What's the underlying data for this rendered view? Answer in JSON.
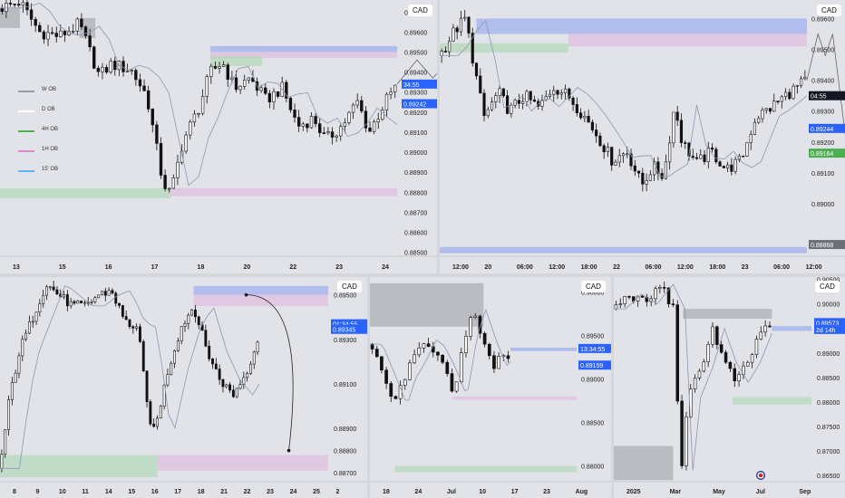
{
  "currency_tag": "CAD",
  "colors": {
    "bull": "#ffffff",
    "bear": "#111111",
    "wick": "#111111",
    "axis_text": "#222222",
    "blue_zone": "#8aa0f0",
    "pink_zone": "#e0b3df",
    "green_zone": "#a7d7a9",
    "gray_zone": "#9a9ca3",
    "label_blue": "#2962ff",
    "label_dark": "#131722",
    "label_green": "#4caf50"
  },
  "legend": [
    {
      "label": "W OB",
      "color": "#9a9ca3"
    },
    {
      "label": "D OB",
      "color": "#ffffff"
    },
    {
      "label": "4H OB",
      "color": "#4caf50"
    },
    {
      "label": "1H OB",
      "color": "#d58ad3"
    },
    {
      "label": "15' OB",
      "color": "#64b5f6"
    }
  ],
  "chart_data": [
    {
      "id": "p1",
      "type": "candlestick",
      "timeframe": "4H",
      "x_ticks": [
        "13",
        "15",
        "16",
        "17",
        "18",
        "20",
        "22",
        "23",
        "24"
      ],
      "ylim": [
        0.8848,
        0.8976
      ],
      "y_ticks": [
        "0.89700",
        "0.89600",
        "0.89500",
        "0.89400",
        "0.89300",
        "0.89200",
        "0.89100",
        "0.89000",
        "0.88900",
        "0.88800",
        "0.88700",
        "0.88600",
        "0.88500"
      ],
      "tick_values": [
        0.897,
        0.896,
        0.895,
        0.894,
        0.893,
        0.892,
        0.891,
        0.89,
        0.889,
        0.888,
        0.887,
        0.886,
        0.885
      ],
      "top_partial_tick": "0.89600",
      "price_labels": [
        {
          "text": "34:55",
          "value": 0.8934,
          "color": "#2962ff"
        },
        {
          "text": "0.89242",
          "value": 0.89242,
          "color": "#2962ff"
        }
      ],
      "path": [
        [
          0,
          0.8972
        ],
        [
          0.05,
          0.8975
        ],
        [
          0.1,
          0.896
        ],
        [
          0.15,
          0.8958
        ],
        [
          0.2,
          0.8964
        ],
        [
          0.25,
          0.8938
        ],
        [
          0.28,
          0.8944
        ],
        [
          0.33,
          0.8941
        ],
        [
          0.37,
          0.8928
        ],
        [
          0.41,
          0.8885
        ],
        [
          0.43,
          0.8879
        ],
        [
          0.46,
          0.8905
        ],
        [
          0.5,
          0.8922
        ],
        [
          0.53,
          0.894
        ],
        [
          0.56,
          0.8945
        ],
        [
          0.59,
          0.8932
        ],
        [
          0.63,
          0.8937
        ],
        [
          0.67,
          0.8926
        ],
        [
          0.71,
          0.8932
        ],
        [
          0.75,
          0.8913
        ],
        [
          0.79,
          0.8917
        ],
        [
          0.82,
          0.8906
        ],
        [
          0.86,
          0.8913
        ],
        [
          0.9,
          0.8925
        ],
        [
          0.93,
          0.891
        ],
        [
          0.97,
          0.8925
        ],
        [
          1,
          0.8934
        ]
      ],
      "zones": [
        {
          "x0": 0.53,
          "x1": 1.0,
          "y0": 0.895,
          "y1": 0.8953,
          "kind": "blue_zone"
        },
        {
          "x0": 0.53,
          "x1": 1.0,
          "y0": 0.8947,
          "y1": 0.895,
          "kind": "pink_zone"
        },
        {
          "x0": 0.53,
          "x1": 0.66,
          "y0": 0.8943,
          "y1": 0.8948,
          "kind": "green_zone"
        },
        {
          "x0": 0.0,
          "x1": 0.43,
          "y0": 0.8877,
          "y1": 0.8882,
          "kind": "green_zone"
        },
        {
          "x0": 0.43,
          "x1": 1.0,
          "y0": 0.8878,
          "y1": 0.8882,
          "kind": "pink_zone"
        },
        {
          "x0": 0.0,
          "x1": 0.05,
          "y0": 0.8962,
          "y1": 0.8972,
          "kind": "gray_zone"
        },
        {
          "x0": 0.2,
          "x1": 0.24,
          "y0": 0.8957,
          "y1": 0.8967,
          "kind": "gray_zone"
        }
      ],
      "projection": [
        [
          1.0,
          0.8934
        ],
        [
          1.05,
          0.8946
        ],
        [
          1.09,
          0.8937
        ],
        [
          1.14,
          0.8948
        ],
        [
          1.2,
          0.892
        ]
      ]
    },
    {
      "id": "p2",
      "type": "candlestick",
      "timeframe": "15m",
      "x_ticks": [
        "12:00",
        "20",
        "06:00",
        "12:00",
        "18:00",
        "22",
        "06:00",
        "12:00",
        "18:00",
        "23",
        "06:00",
        "12:00"
      ],
      "ylim": [
        0.8883,
        0.8966
      ],
      "y_ticks": [
        "0.89600",
        "0.89500",
        "0.89400",
        "0.89300",
        "0.89200",
        "0.89100",
        "0.89000"
      ],
      "tick_values": [
        0.896,
        0.895,
        0.894,
        0.893,
        0.892,
        0.891,
        0.89
      ],
      "price_labels": [
        {
          "text": "04:55",
          "value": 0.8935,
          "color": "#131722"
        },
        {
          "text": "0.89244",
          "value": 0.89244,
          "color": "#2962ff"
        },
        {
          "text": "0.89164",
          "value": 0.89164,
          "color": "#4caf50"
        },
        {
          "text": "0.88868",
          "value": 0.88868,
          "color": "#6e7079"
        }
      ],
      "path": [
        [
          0,
          0.8948
        ],
        [
          0.04,
          0.8956
        ],
        [
          0.07,
          0.896
        ],
        [
          0.09,
          0.8947
        ],
        [
          0.12,
          0.8928
        ],
        [
          0.16,
          0.8936
        ],
        [
          0.19,
          0.893
        ],
        [
          0.23,
          0.8935
        ],
        [
          0.27,
          0.8931
        ],
        [
          0.31,
          0.8938
        ],
        [
          0.35,
          0.8935
        ],
        [
          0.39,
          0.8929
        ],
        [
          0.43,
          0.8922
        ],
        [
          0.47,
          0.8914
        ],
        [
          0.51,
          0.8917
        ],
        [
          0.55,
          0.8906
        ],
        [
          0.58,
          0.8912
        ],
        [
          0.61,
          0.8909
        ],
        [
          0.64,
          0.8932
        ],
        [
          0.66,
          0.892
        ],
        [
          0.7,
          0.8913
        ],
        [
          0.74,
          0.8917
        ],
        [
          0.78,
          0.8911
        ],
        [
          0.82,
          0.8914
        ],
        [
          0.86,
          0.8928
        ],
        [
          0.9,
          0.8931
        ],
        [
          0.94,
          0.8935
        ],
        [
          1,
          0.894
        ]
      ],
      "zones": [
        {
          "x0": 0.1,
          "x1": 1.0,
          "y0": 0.8955,
          "y1": 0.896,
          "kind": "blue_zone"
        },
        {
          "x0": 0.35,
          "x1": 1.0,
          "y0": 0.8951,
          "y1": 0.8955,
          "kind": "pink_zone"
        },
        {
          "x0": 0.0,
          "x1": 0.35,
          "y0": 0.8949,
          "y1": 0.8952,
          "kind": "green_zone"
        },
        {
          "x0": 0.0,
          "x1": 1.0,
          "y0": 0.8884,
          "y1": 0.8886,
          "kind": "blue_zone"
        }
      ],
      "projection": [
        [
          1.0,
          0.894
        ],
        [
          1.03,
          0.8955
        ],
        [
          1.05,
          0.8948
        ],
        [
          1.07,
          0.8955
        ],
        [
          1.11,
          0.8917
        ]
      ]
    },
    {
      "id": "p3",
      "type": "candlestick",
      "timeframe": "1H",
      "x_ticks": [
        "8",
        "9",
        "10",
        "11",
        "14",
        "15",
        "16",
        "17",
        "18",
        "21",
        "22",
        "23",
        "24",
        "25",
        "2"
      ],
      "ylim": [
        0.8866,
        0.8958
      ],
      "y_ticks": [
        "0.89500",
        "0.89300",
        "0.89100",
        "0.88900",
        "0.88700"
      ],
      "tick_values": [
        0.895,
        0.893,
        0.891,
        0.889,
        0.887
      ],
      "extra_ticks": [
        "0.88800"
      ],
      "extra_tick_values": [
        0.888
      ],
      "price_labels": [
        {
          "text": "01:34:55",
          "value": 0.8937,
          "color": "#2962ff"
        },
        {
          "text": "0.89345",
          "value": 0.89345,
          "color": "#2962ff"
        }
      ],
      "path": [
        [
          0,
          0.8872
        ],
        [
          0.03,
          0.8905
        ],
        [
          0.06,
          0.8925
        ],
        [
          0.1,
          0.894
        ],
        [
          0.14,
          0.8955
        ],
        [
          0.18,
          0.895
        ],
        [
          0.22,
          0.8945
        ],
        [
          0.26,
          0.8945
        ],
        [
          0.3,
          0.895
        ],
        [
          0.34,
          0.8952
        ],
        [
          0.38,
          0.8938
        ],
        [
          0.42,
          0.8935
        ],
        [
          0.45,
          0.8898
        ],
        [
          0.47,
          0.8888
        ],
        [
          0.51,
          0.8915
        ],
        [
          0.55,
          0.8935
        ],
        [
          0.59,
          0.8945
        ],
        [
          0.63,
          0.8925
        ],
        [
          0.67,
          0.8912
        ],
        [
          0.71,
          0.8905
        ],
        [
          0.75,
          0.8915
        ],
        [
          0.79,
          0.8932
        ]
      ],
      "zones": [
        {
          "x0": 0.59,
          "x1": 1.0,
          "y0": 0.895,
          "y1": 0.8954,
          "kind": "blue_zone"
        },
        {
          "x0": 0.59,
          "x1": 1.0,
          "y0": 0.8945,
          "y1": 0.895,
          "kind": "pink_zone"
        },
        {
          "x0": 0.0,
          "x1": 0.48,
          "y0": 0.8868,
          "y1": 0.8878,
          "kind": "green_zone"
        },
        {
          "x0": 0.48,
          "x1": 1.0,
          "y0": 0.8871,
          "y1": 0.8878,
          "kind": "pink_zone"
        }
      ],
      "arc_end": [
        0.88,
        0.888
      ]
    },
    {
      "id": "p4",
      "type": "candlestick",
      "timeframe": "D",
      "x_ticks": [
        "18",
        "24",
        "Jul",
        "10",
        "17",
        "23",
        "Aug"
      ],
      "ylim": [
        0.8782,
        0.9017
      ],
      "y_ticks": [
        "0.90000",
        "0.89500",
        "0.89000",
        "0.88500",
        "0.88000"
      ],
      "tick_values": [
        0.9,
        0.895,
        0.89,
        0.885,
        0.88
      ],
      "price_labels": [
        {
          "text": "13:34:55",
          "value": 0.8935,
          "color": "#2962ff"
        },
        {
          "text": "0.89159",
          "value": 0.89159,
          "color": "#2962ff"
        }
      ],
      "path": [
        [
          0,
          0.894
        ],
        [
          0.07,
          0.89
        ],
        [
          0.12,
          0.887
        ],
        [
          0.16,
          0.89
        ],
        [
          0.21,
          0.892
        ],
        [
          0.26,
          0.8945
        ],
        [
          0.3,
          0.8938
        ],
        [
          0.35,
          0.8915
        ],
        [
          0.41,
          0.888
        ],
        [
          0.46,
          0.895
        ],
        [
          0.5,
          0.898
        ],
        [
          0.55,
          0.8945
        ],
        [
          0.6,
          0.8915
        ],
        [
          0.64,
          0.8925
        ],
        [
          0.68,
          0.8915
        ]
      ],
      "zones": [
        {
          "x0": 0.0,
          "x1": 0.55,
          "y0": 0.896,
          "y1": 0.901,
          "kind": "gray_zone"
        },
        {
          "x0": 0.68,
          "x1": 1.0,
          "y0": 0.8932,
          "y1": 0.8936,
          "kind": "blue_zone"
        },
        {
          "x0": 0.4,
          "x1": 1.0,
          "y0": 0.8876,
          "y1": 0.888,
          "kind": "pink_zone"
        },
        {
          "x0": 0.12,
          "x1": 1.0,
          "y0": 0.8793,
          "y1": 0.88,
          "kind": "green_zone"
        }
      ]
    },
    {
      "id": "p5",
      "type": "candlestick",
      "timeframe": "W",
      "x_ticks": [
        "2025",
        "Mar",
        "May",
        "Jul",
        "Sep"
      ],
      "ylim": [
        0.8637,
        0.9055
      ],
      "y_ticks": [
        "0.90500",
        "0.90000",
        "0.89500",
        "0.89000",
        "0.88500",
        "0.88000",
        "0.87500",
        "0.87000",
        "0.86500"
      ],
      "tick_values": [
        0.905,
        0.9,
        0.895,
        0.89,
        0.885,
        0.88,
        0.875,
        0.87,
        0.865
      ],
      "price_labels": [
        {
          "text": "0.89573",
          "value": 0.8962,
          "color": "#2962ff"
        },
        {
          "text": "2d 14h",
          "value": 0.8948,
          "color": "#2962ff"
        }
      ],
      "path": [
        [
          0,
          0.899
        ],
        [
          0.08,
          0.902
        ],
        [
          0.16,
          0.9
        ],
        [
          0.24,
          0.904
        ],
        [
          0.3,
          0.899
        ],
        [
          0.34,
          0.866
        ],
        [
          0.38,
          0.881
        ],
        [
          0.44,
          0.887
        ],
        [
          0.5,
          0.895
        ],
        [
          0.56,
          0.888
        ],
        [
          0.62,
          0.884
        ],
        [
          0.68,
          0.888
        ],
        [
          0.74,
          0.894
        ],
        [
          0.77,
          0.896
        ],
        [
          0.8,
          0.8935
        ]
      ],
      "zones": [
        {
          "x0": 0.35,
          "x1": 0.8,
          "y0": 0.897,
          "y1": 0.899,
          "kind": "gray_zone"
        },
        {
          "x0": 0.0,
          "x1": 0.3,
          "y0": 0.864,
          "y1": 0.871,
          "kind": "gray_zone"
        },
        {
          "x0": 0.6,
          "x1": 1.0,
          "y0": 0.8795,
          "y1": 0.881,
          "kind": "green_zone"
        },
        {
          "x0": 0.8,
          "x1": 1.0,
          "y0": 0.8945,
          "y1": 0.8955,
          "kind": "blue_zone"
        }
      ]
    }
  ]
}
